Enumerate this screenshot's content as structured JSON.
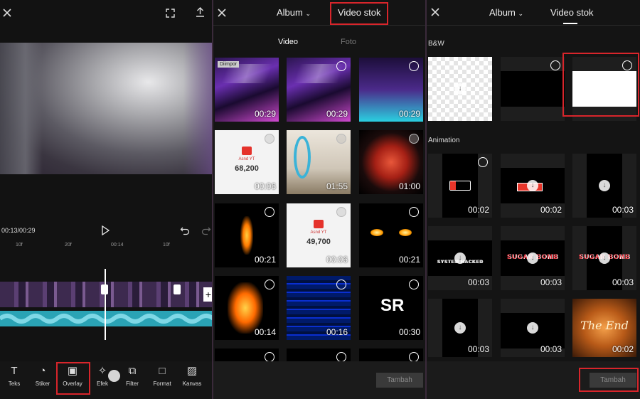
{
  "editor": {
    "time": "00:13/00:29",
    "ruler": [
      "10f",
      "20f",
      "00:14",
      "10f"
    ],
    "tools": [
      {
        "label": "Teks",
        "icon": "text-icon"
      },
      {
        "label": "Stiker",
        "icon": "sticker-icon"
      },
      {
        "label": "Overlay",
        "icon": "overlay-icon"
      },
      {
        "label": "Efek",
        "icon": "effect-icon"
      },
      {
        "label": "Filter",
        "icon": "filter-icon"
      },
      {
        "label": "Format",
        "icon": "format-icon"
      },
      {
        "label": "Kanvas",
        "icon": "canvas-icon"
      }
    ]
  },
  "picker1": {
    "tabs": {
      "album": "Album",
      "stock": "Video stok"
    },
    "subtabs": {
      "video": "Video",
      "photo": "Foto"
    },
    "imported_tag": "Diimpor",
    "grid": [
      {
        "duration": "00:29",
        "style": "stage"
      },
      {
        "duration": "00:29",
        "style": "stage"
      },
      {
        "duration": "00:29",
        "style": "stage2"
      },
      {
        "duration": "00:06",
        "style": "white",
        "caption": "Asnd YT",
        "count": "68,200"
      },
      {
        "duration": "01:55",
        "style": "mosque"
      },
      {
        "duration": "01:00",
        "style": "red"
      },
      {
        "duration": "00:21",
        "style": "fire"
      },
      {
        "duration": "00:06",
        "style": "white",
        "caption": "Asnd YT",
        "count": "49,700"
      },
      {
        "duration": "00:21",
        "style": "eyes"
      },
      {
        "duration": "00:14",
        "style": "bigfire"
      },
      {
        "duration": "00:16",
        "style": "glitch"
      },
      {
        "duration": "00:30",
        "style": "sr",
        "overlay_text": "SR"
      }
    ],
    "add_button": "Tambah"
  },
  "picker2": {
    "tabs": {
      "album": "Album",
      "stock": "Video stok"
    },
    "sections": {
      "bw": "B&W",
      "animation": "Animation"
    },
    "animation_grid": [
      {
        "duration": "00:02"
      },
      {
        "duration": "00:02"
      },
      {
        "duration": "00:03"
      },
      {
        "duration": "00:03",
        "text": "SYSTEM HACKED"
      },
      {
        "duration": "00:03",
        "text": "SUGAR BOMB"
      },
      {
        "duration": "00:03",
        "text": "SUGAR BOMB"
      },
      {
        "duration": "00:03"
      },
      {
        "duration": "00:03"
      },
      {
        "duration": "00:02",
        "text": "The End"
      }
    ],
    "add_button": "Tambah"
  }
}
